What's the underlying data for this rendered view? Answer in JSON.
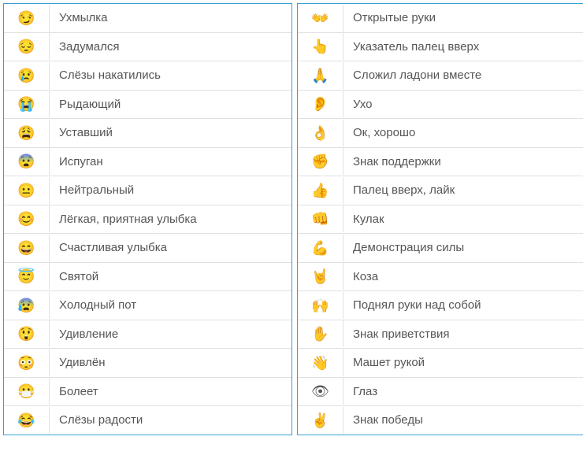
{
  "left": [
    {
      "emoji": "😏",
      "label": "Ухмылка"
    },
    {
      "emoji": "😔",
      "label": "Задумался"
    },
    {
      "emoji": "😢",
      "label": "Слёзы накатились"
    },
    {
      "emoji": "😭",
      "label": "Рыдающий"
    },
    {
      "emoji": "😩",
      "label": "Уставший"
    },
    {
      "emoji": "😨",
      "label": "Испуган"
    },
    {
      "emoji": "😐",
      "label": "Нейтральный"
    },
    {
      "emoji": "😊",
      "label": "Лёгкая, приятная улыбка"
    },
    {
      "emoji": "😄",
      "label": "Счастливая улыбка"
    },
    {
      "emoji": "😇",
      "label": "Святой"
    },
    {
      "emoji": "😰",
      "label": "Холодный пот"
    },
    {
      "emoji": "😲",
      "label": "Удивление"
    },
    {
      "emoji": "😳",
      "label": "Удивлён"
    },
    {
      "emoji": "😷",
      "label": "Болеет"
    },
    {
      "emoji": "😂",
      "label": "Слёзы радости"
    }
  ],
  "right": [
    {
      "emoji": "👐",
      "label": "Открытые руки"
    },
    {
      "emoji": "👆",
      "label": "Указатель палец вверх"
    },
    {
      "emoji": "🙏",
      "label": "Сложил ладони вместе"
    },
    {
      "emoji": "👂",
      "label": "Ухо"
    },
    {
      "emoji": "👌",
      "label": "Ок, хорошо"
    },
    {
      "emoji": "✊",
      "label": "Знак поддержки"
    },
    {
      "emoji": "👍",
      "label": "Палец вверх, лайк"
    },
    {
      "emoji": "👊",
      "label": "Кулак"
    },
    {
      "emoji": "💪",
      "label": "Демонстрация силы"
    },
    {
      "emoji": "🤘",
      "label": "Коза"
    },
    {
      "emoji": "🙌",
      "label": "Поднял руки над собой"
    },
    {
      "emoji": "✋",
      "label": "Знак приветствия"
    },
    {
      "emoji": "👋",
      "label": "Машет рукой"
    },
    {
      "emoji": "👁",
      "label": "Глаз"
    },
    {
      "emoji": "✌",
      "label": "Знак победы"
    }
  ]
}
